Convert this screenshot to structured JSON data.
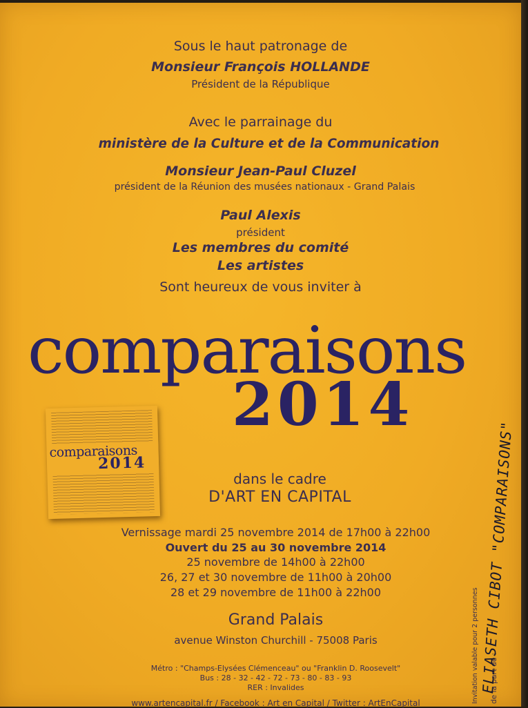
{
  "patronage": {
    "line1": "Sous le haut patronage de",
    "name": "Monsieur François HOLLANDE",
    "role": "Président de la République"
  },
  "sponsorship": {
    "line1": "Avec le parrainage du",
    "ministry": "ministère de la Culture et de la Communication",
    "name": "Monsieur Jean-Paul Cluzel",
    "role": "président de la Réunion des musées nationaux - Grand Palais"
  },
  "hosts": {
    "name": "Paul Alexis",
    "role": "président",
    "committee": "Les membres du comité",
    "artists": "Les artistes",
    "invite": "Sont heureux de vous inviter à"
  },
  "event": {
    "title": "comparaisons",
    "year": "2014",
    "frame1": "dans le cadre",
    "frame2": "D'ART EN CAPITAL"
  },
  "thumbnail": {
    "title": "comparaisons",
    "year": "2014"
  },
  "schedule": {
    "vernissage": "Vernissage mardi 25 novembre 2014 de 17h00 à 22h00",
    "open": "Ouvert du 25 au 30 novembre 2014",
    "day1": "25 novembre de 14h00 à 22h00",
    "day2": "26, 27 et 30 novembre de 11h00 à 20h00",
    "day3": "28 et 29 novembre de 11h00 à 22h00"
  },
  "venue": {
    "name": "Grand Palais",
    "address": "avenue Winston Churchill - 75008 Paris"
  },
  "transport": {
    "metro": "Métro : \"Champs-Elysées Clémenceau\" ou \"Franklin D. Roosevelt\"",
    "bus": "Bus : 28 - 32 - 42 - 72 - 73 - 80 - 83 - 93",
    "rer": "RER : Invalides"
  },
  "footer": {
    "links": "www.artencapital.fr / Facebook : Art en Capital / Twitter : ArtEnCapital"
  },
  "side_text": {
    "validity": "Invitation valable pour 2 personnes",
    "part": "de la part de :"
  },
  "handwriting": {
    "text": "ELIASETH CIBOT \"COMPARAISONS\""
  }
}
